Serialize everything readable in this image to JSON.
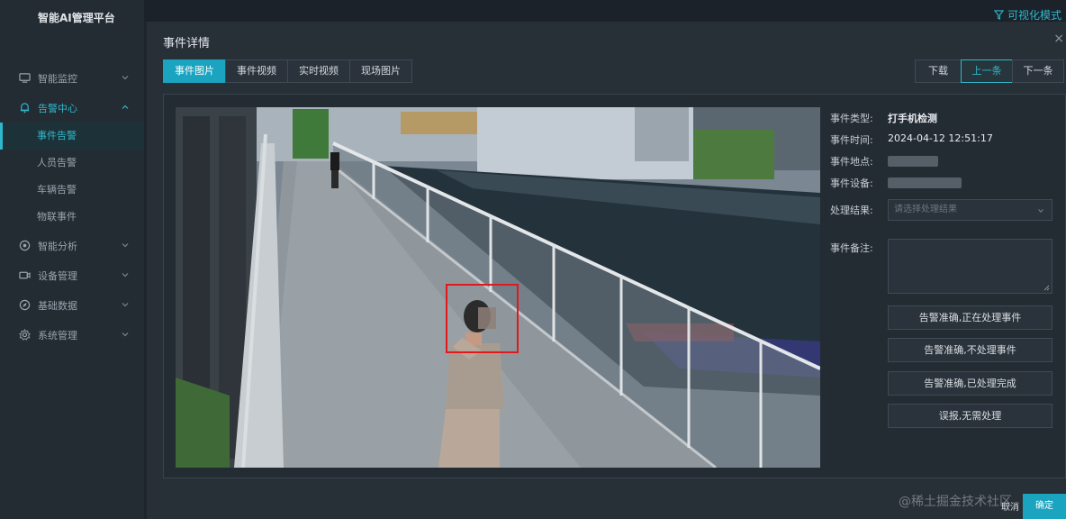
{
  "app": {
    "brand": "智能AI管理平台",
    "mode_link": "可视化模式"
  },
  "sidebar": {
    "items": [
      {
        "label": "智能监控",
        "icon": "monitor-icon"
      },
      {
        "label": "告警中心",
        "icon": "bell-icon"
      },
      {
        "label": "智能分析",
        "icon": "target-icon"
      },
      {
        "label": "设备管理",
        "icon": "camera-icon"
      },
      {
        "label": "基础数据",
        "icon": "compass-icon"
      },
      {
        "label": "系统管理",
        "icon": "gear-icon"
      }
    ],
    "sub_items": [
      "事件告警",
      "人员告警",
      "车辆告警",
      "物联事件"
    ]
  },
  "modal": {
    "title": "事件详情",
    "close": "×",
    "tabs": [
      "事件图片",
      "事件视频",
      "实时视频",
      "现场图片"
    ],
    "actions": {
      "download": "下载",
      "prev": "上一条",
      "next": "下一条"
    },
    "details": {
      "type_label": "事件类型:",
      "type_value": "打手机检测",
      "time_label": "事件时间:",
      "time_value": "2024-04-12 12:51:17",
      "location_label": "事件地点:",
      "device_label": "事件设备:",
      "result_label": "处理结果:",
      "result_placeholder": "请选择处理结果",
      "remark_label": "事件备注:"
    },
    "buttons": [
      "告警准确,正在处理事件",
      "告警准确,不处理事件",
      "告警准确,已处理完成",
      "误报,无需处理"
    ],
    "footer": {
      "cancel": "取消",
      "ok": "确定"
    }
  },
  "watermark": "@稀土掘金技术社区",
  "colors": {
    "accent": "#1aa4bf",
    "detection_box": "#e0191e"
  }
}
